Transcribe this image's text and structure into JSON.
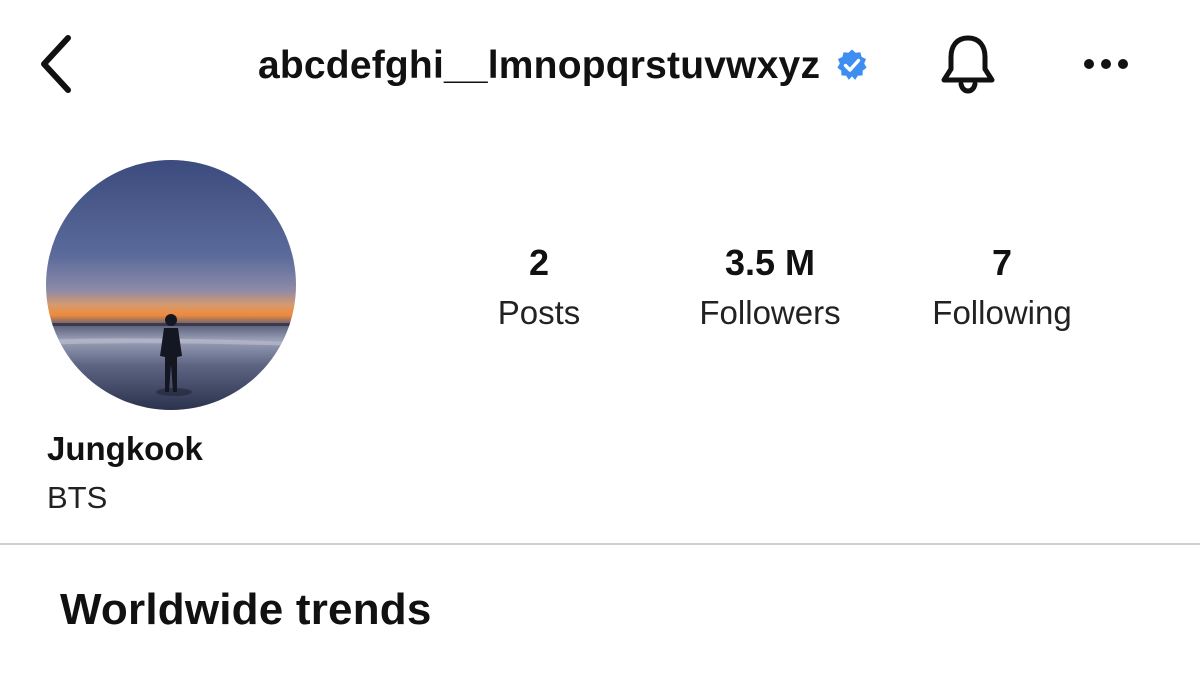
{
  "header": {
    "username": "abcdefghi__lmnopqrstuvwxyz",
    "back_icon": "chevron-left-icon",
    "verified_icon": "verified-badge-icon",
    "bell_icon": "bell-icon",
    "more_icon": "more-horizontal-icon"
  },
  "profile": {
    "avatar": "sunset-beach-silhouette",
    "display_name": "Jungkook",
    "bio": "BTS"
  },
  "stats": [
    {
      "value": "2",
      "label": "Posts"
    },
    {
      "value": "3.5 M",
      "label": "Followers"
    },
    {
      "value": "7",
      "label": "Following"
    }
  ],
  "section": {
    "title": "Worldwide trends"
  },
  "colors": {
    "verified_blue": "#3d8ef0",
    "text": "#111111",
    "divider": "#cfcfcf"
  }
}
